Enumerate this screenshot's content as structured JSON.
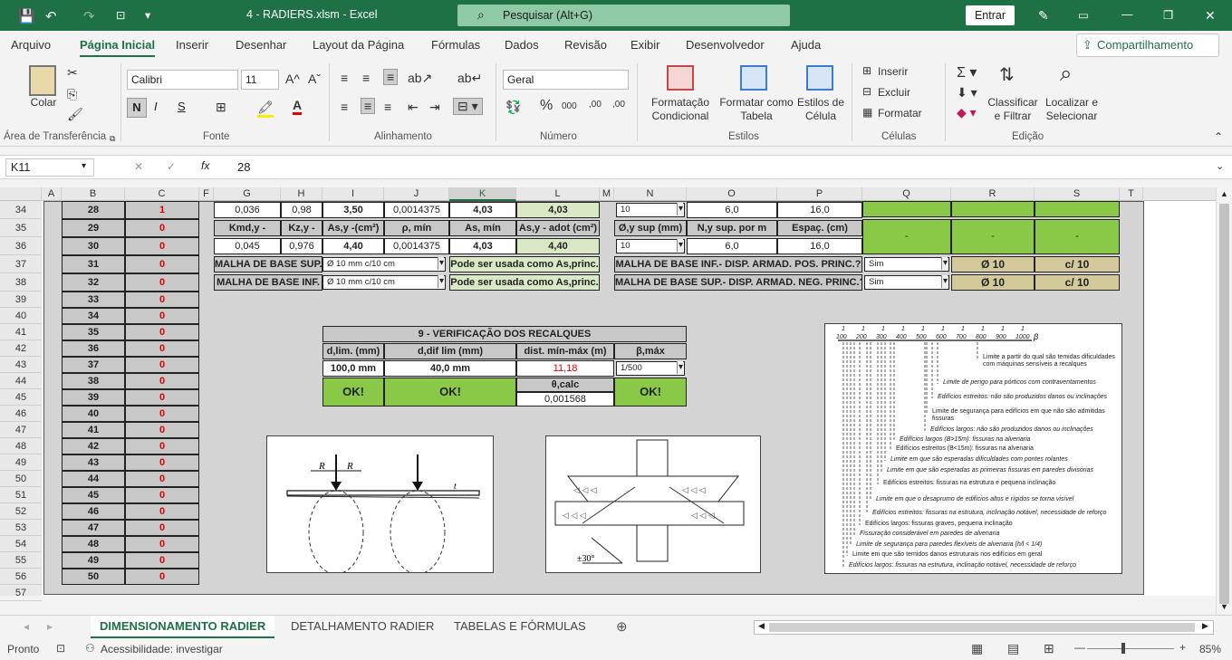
{
  "titlebar": {
    "filename": "4 - RADIERS.xlsm",
    "app": "Excel",
    "search": "Pesquisar (Alt+G)",
    "signin": "Entrar"
  },
  "menu": [
    "Arquivo",
    "Página Inicial",
    "Inserir",
    "Desenhar",
    "Layout da Página",
    "Fórmulas",
    "Dados",
    "Revisão",
    "Exibir",
    "Desenvolvedor",
    "Ajuda"
  ],
  "share": "Compartilhamento",
  "ribbon": {
    "paste": "Colar",
    "font_name": "Calibri",
    "font_size": "11",
    "bold": "N",
    "italic": "I",
    "underline": "S",
    "number_format": "Geral",
    "cond_format": "Formatação Condicional",
    "format_table": "Formatar como Tabela",
    "cell_styles": "Estilos de Célula",
    "insert": "Inserir",
    "delete": "Excluir",
    "format": "Formatar",
    "sort_filter": "Classificar e Filtrar",
    "find_select": "Localizar e Selecionar",
    "groups": {
      "clipboard": "Área de Transferência",
      "font": "Fonte",
      "alignment": "Alinhamento",
      "number": "Número",
      "styles": "Estilos",
      "cells": "Células",
      "editing": "Edição"
    }
  },
  "formula_bar": {
    "name_box": "K11",
    "value": "28",
    "fx": "fx"
  },
  "columns": [
    "A",
    "B",
    "C",
    "F",
    "G",
    "H",
    "I",
    "J",
    "K",
    "L",
    "M",
    "N",
    "O",
    "P",
    "Q",
    "R",
    "S",
    "T"
  ],
  "rows": [
    "34",
    "35",
    "36",
    "37",
    "38",
    "39",
    "40",
    "41",
    "42",
    "43",
    "44",
    "45",
    "46",
    "47",
    "48",
    "49",
    "50",
    "51",
    "52",
    "53",
    "54",
    "55",
    "56",
    "57"
  ],
  "list_b": [
    "28",
    "29",
    "30",
    "31",
    "32",
    "33",
    "34",
    "35",
    "36",
    "37",
    "38",
    "39",
    "40",
    "41",
    "42",
    "43",
    "44",
    "45",
    "46",
    "47",
    "48",
    "49",
    "50"
  ],
  "list_c": [
    "1",
    "0",
    "0",
    "0",
    "0",
    "0",
    "0",
    "0",
    "0",
    "0",
    "0",
    "0",
    "0",
    "0",
    "0",
    "0",
    "0",
    "0",
    "0",
    "0",
    "0",
    "0",
    "0"
  ],
  "table_y": {
    "row34": [
      "0,036",
      "0,98",
      "3,50",
      "0,0014375",
      "4,03",
      "4,03"
    ],
    "headers": [
      "Kmd,y -",
      "Kz,y -",
      "As,y -(cm²)",
      "ρ, mín",
      "As, mín",
      "As,y - adot (cm²)"
    ],
    "row36": [
      "0,045",
      "0,976",
      "4,40",
      "0,0014375",
      "4,03",
      "4,40"
    ],
    "malha_base_sup": "MALHA DE BASE SUP.",
    "malha_base_inf": "MALHA DE BASE INF.",
    "malha_sel": "Ø 10 mm c/10 cm",
    "malha_note": "Pode ser usada como As,princ."
  },
  "table_n": {
    "row34": [
      "10",
      "6,0",
      "16,0"
    ],
    "headers": [
      "Ø,y sup (mm)",
      "N,y sup. por m",
      "Espaç. (cm)"
    ],
    "row36": [
      "10",
      "6,0",
      "16,0"
    ],
    "dashes": [
      "-",
      "-",
      "-"
    ],
    "row37_label": "MALHA  DE BASE INF.- DISP. ARMAD. POS. PRINC.?",
    "row38_label": "MALHA DE BASE SUP.- DISP. ARMAD. NEG. PRINC.?",
    "sim": "Sim",
    "phi": "Ø 10",
    "c": "c/ 10"
  },
  "recalques": {
    "title": "9 - VERIFICAÇÃO DOS RECALQUES",
    "headers": [
      "d,lim. (mm)",
      "d,dif lim (mm)",
      "dist. mín-máx (m)",
      "β,máx"
    ],
    "values": [
      "100,0 mm",
      "40,0 mm",
      "11,18",
      "1/500"
    ],
    "ok": "OK!",
    "theta_label": "θ,calc",
    "theta_value": "0,001568"
  },
  "fig_right": {
    "axis": [
      "1",
      "1",
      "1",
      "1",
      "1",
      "1",
      "1",
      "1",
      "1",
      "1"
    ],
    "axis_den": [
      "100",
      "200",
      "300",
      "400",
      "500",
      "600",
      "700",
      "800",
      "900",
      "1000"
    ],
    "beta": "β",
    "notes": [
      "Limite a partir do qual são temidas dificuldades com máquinas sensíveis a recalques",
      "Limite de perigo para pórticos com contraventamentos",
      "Edifícios estreitos: não são produzidos danos ou inclinações",
      "Limite de segurança para edifícios em que não são admitidas fissuras",
      "Edifícios largos: não são produzidos danos ou inclinações",
      "Edifícios largos (B>15m): fissuras na alvenaria",
      "Edifícios estreitos (B<15m): fissuras na alvenaria",
      "Limite em que são esperadas dificuldades com pontes rolantes",
      "Limite em que são esperadas as primeiras fissuras em paredes divisórias",
      "Edifícios estreitos: fissuras na estrutura e pequena inclinação",
      "Limite em que o desaprumo de edifícios altos e rígidos se torna visível",
      "Edifícios estreitos: fissuras na estrutura, inclinação notável, necessidade de reforço",
      "Edifícios largos: fissuras graves, pequena inclinação",
      "Fissuração considerável em paredes de alvenaria",
      "Limite de segurança para paredes flexíveis de alvenaria (h/l < 1/4)",
      "Limite em que são temidos danos estruturais nos edifícios em geral",
      "Edifícios largos: fissuras na estrutura, inclinação notável, necessidade de reforço"
    ]
  },
  "fig_left": {
    "label_r": "R",
    "label_t": "t"
  },
  "fig_mid": {
    "angle": "±30°"
  },
  "sheets": [
    "DIMENSIONAMENTO RADIER",
    "DETALHAMENTO RADIER",
    "TABELAS E FÓRMULAS"
  ],
  "status": {
    "ready": "Pronto",
    "accessibility": "Acessibilidade: investigar",
    "zoom": "85%"
  },
  "colors": {
    "green": "#1e7145",
    "cell_green": "#8ac947",
    "tan": "#d4c99a"
  }
}
